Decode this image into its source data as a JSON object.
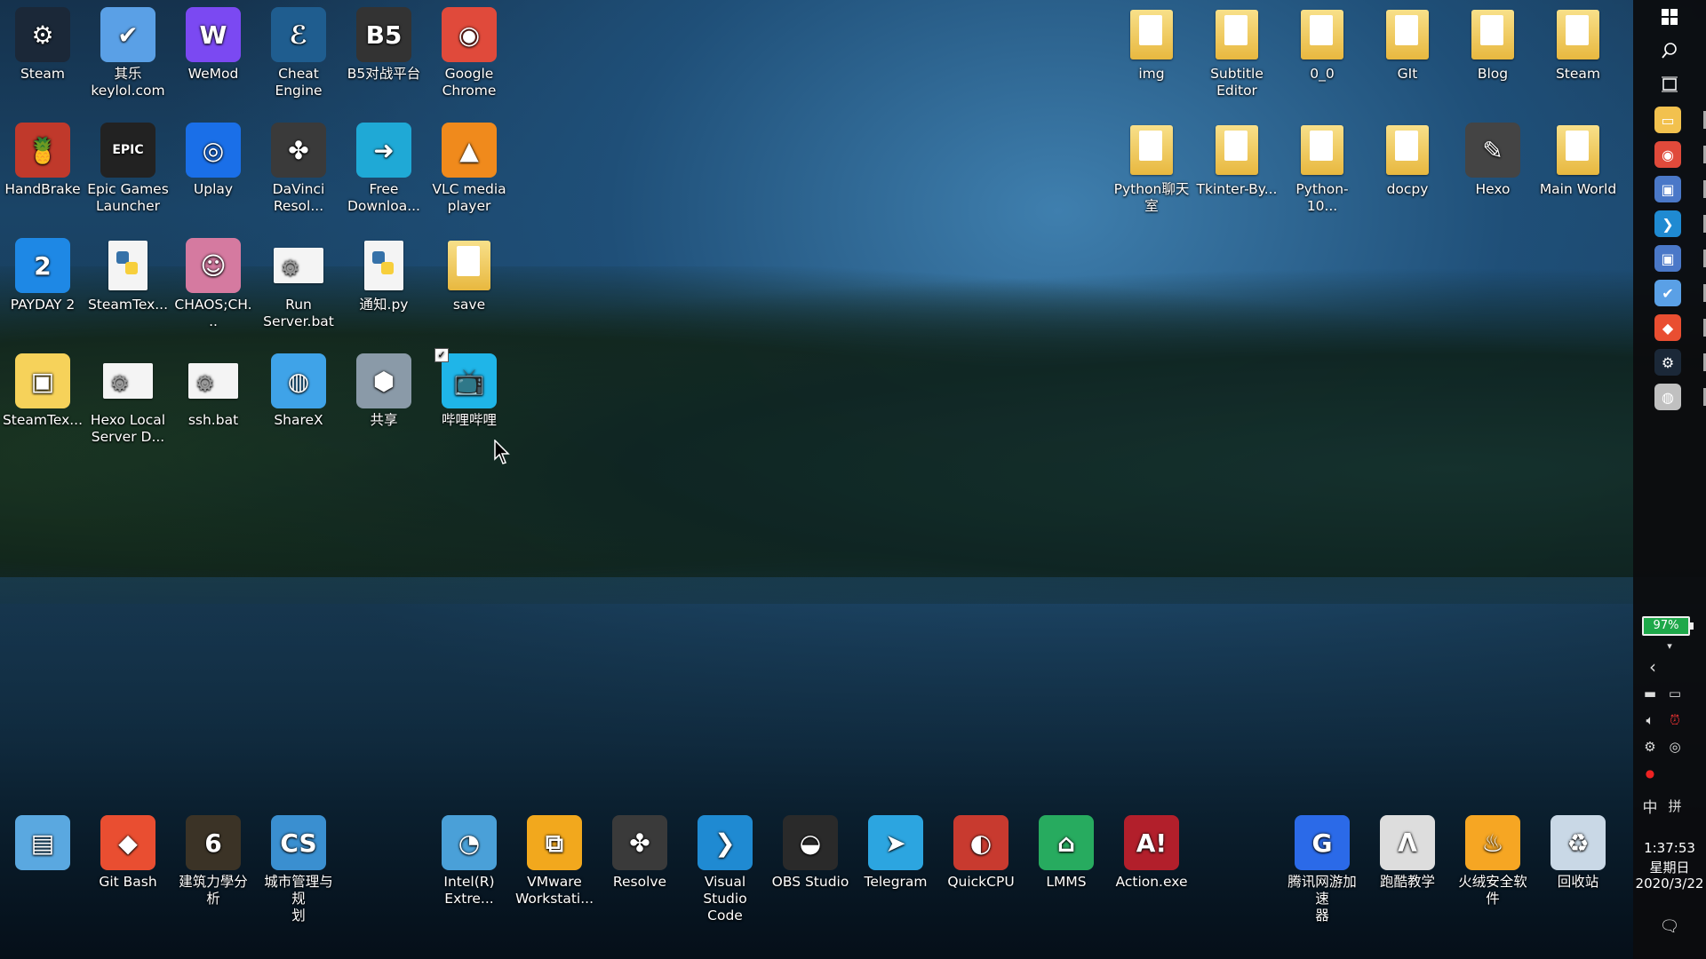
{
  "desktop": {
    "wallpaper": "misty forest lake at dusk",
    "icons": [
      {
        "label": "Steam",
        "icon": "steam-icon",
        "color": "#1b2838"
      },
      {
        "label": "其乐\nkeylol.com",
        "icon": "keylol-icon",
        "color": "#5aa0e6"
      },
      {
        "label": "WeMod",
        "icon": "wemod-icon",
        "color": "#7b49f2"
      },
      {
        "label": "Cheat\nEngine",
        "icon": "cheat-engine-icon",
        "color": "#1f5d8f"
      },
      {
        "label": "B5对战平台",
        "icon": "b5-icon",
        "color": "#333333"
      },
      {
        "label": "Google\nChrome",
        "icon": "chrome-icon",
        "color": "#e04a3b"
      },
      {
        "label": "HandBrake",
        "icon": "handbrake-icon",
        "color": "#c0392b"
      },
      {
        "label": "Epic Games\nLauncher",
        "icon": "epic-games-icon",
        "color": "#222222"
      },
      {
        "label": "Uplay",
        "icon": "uplay-icon",
        "color": "#1a6fe8"
      },
      {
        "label": "DaVinci\nResol...",
        "icon": "davinci-icon",
        "color": "#3a3a3a"
      },
      {
        "label": "Free\nDownloa...",
        "icon": "free-download-icon",
        "color": "#1fa9d6"
      },
      {
        "label": "VLC media\nplayer",
        "icon": "vlc-icon",
        "color": "#f08a1c"
      },
      {
        "label": "PAYDAY 2",
        "icon": "payday-icon",
        "color": "#1e88e5"
      },
      {
        "label": "SteamTex...",
        "icon": "python-file-icon",
        "color": "#f4f4f4"
      },
      {
        "label": "CHAOS;CH...",
        "icon": "chaos-child-icon",
        "color": "#d57aa0"
      },
      {
        "label": "Run\nServer.bat",
        "icon": "batch-file-icon",
        "color": "#f4f4f4"
      },
      {
        "label": "通知.py",
        "icon": "python-file-icon",
        "color": "#f4f4f4"
      },
      {
        "label": "save",
        "icon": "folder-icon",
        "color": "#f0c75a"
      },
      {
        "label": "SteamTex...",
        "icon": "steamtex-app-icon",
        "color": "#f6d25a"
      },
      {
        "label": "Hexo Local\nServer D...",
        "icon": "batch-file-icon",
        "color": "#f4f4f4"
      },
      {
        "label": "ssh.bat",
        "icon": "batch-file-icon",
        "color": "#f4f4f4"
      },
      {
        "label": "ShareX",
        "icon": "sharex-icon",
        "color": "#3fa3e8"
      },
      {
        "label": "共享",
        "icon": "share-box-icon",
        "color": "#8a9aa8"
      },
      {
        "label": "哔哩哔哩",
        "icon": "bilibili-icon",
        "color": "#1fb5e8"
      }
    ],
    "right_icons": [
      {
        "label": "img",
        "icon": "folder-icon"
      },
      {
        "label": "Subtitle\nEditor",
        "icon": "folder-icon"
      },
      {
        "label": "0_0",
        "icon": "folder-icon"
      },
      {
        "label": "GIt",
        "icon": "folder-icon"
      },
      {
        "label": "Blog",
        "icon": "folder-icon"
      },
      {
        "label": "Steam",
        "icon": "folder-icon"
      },
      {
        "label": "Python聊天\n室",
        "icon": "folder-icon"
      },
      {
        "label": "Tkinter-By...",
        "icon": "folder-icon"
      },
      {
        "label": "Python-10...",
        "icon": "folder-icon"
      },
      {
        "label": "docpy",
        "icon": "folder-icon"
      },
      {
        "label": "Hexo",
        "icon": "notepad-icon"
      },
      {
        "label": "Main World",
        "icon": "folder-icon"
      }
    ],
    "bottom_icons": [
      {
        "label": "",
        "icon": "control-panel-icon",
        "color": "#5aa8e0"
      },
      {
        "label": "Git Bash",
        "icon": "git-bash-icon",
        "color": "#e94e31"
      },
      {
        "label": "建筑力學分析",
        "icon": "structural-analysis-icon",
        "color": "#3b3326"
      },
      {
        "label": "城市管理与规\n划",
        "icon": "city-planning-icon",
        "color": "#3a8fd0"
      },
      {
        "label": "Intel(R)\nExtre...",
        "icon": "intel-xtu-icon",
        "color": "#4aa0d8"
      },
      {
        "label": "VMware\nWorkstati...",
        "icon": "vmware-icon",
        "color": "#f2a81d"
      },
      {
        "label": "Resolve",
        "icon": "resolve-icon",
        "color": "#3a3a3a"
      },
      {
        "label": "Visual\nStudio Code",
        "icon": "vscode-icon",
        "color": "#1f8ad2"
      },
      {
        "label": "OBS Studio",
        "icon": "obs-icon",
        "color": "#2a2a2a"
      },
      {
        "label": "Telegram",
        "icon": "telegram-icon",
        "color": "#2ca5e0"
      },
      {
        "label": "QuickCPU",
        "icon": "quickcpu-icon",
        "color": "#c83a2f"
      },
      {
        "label": "LMMS",
        "icon": "lmms-icon",
        "color": "#27ab5f"
      },
      {
        "label": "Action.exe",
        "icon": "action-icon",
        "color": "#b21f2b"
      },
      {
        "label": "腾讯网游加速\n器",
        "icon": "tencent-accel-icon",
        "color": "#2b6ae8"
      },
      {
        "label": "跑酷教学",
        "icon": "assassin-icon",
        "color": "#dddddd"
      },
      {
        "label": "火绒安全软件",
        "icon": "huorong-icon",
        "color": "#f6a623"
      },
      {
        "label": "回收站",
        "icon": "recycle-bin-icon",
        "color": "#c9d8e6"
      }
    ]
  },
  "taskbar": {
    "apps": [
      {
        "icon": "file-explorer-icon",
        "color": "#f2c14e"
      },
      {
        "icon": "chrome-icon",
        "color": "#e04a3b"
      },
      {
        "icon": "remote-desktop-icon",
        "color": "#4a78c8"
      },
      {
        "icon": "vscode-icon",
        "color": "#1f8ad2"
      },
      {
        "icon": "remote-desktop-icon",
        "color": "#4a78c8"
      },
      {
        "icon": "keylol-icon",
        "color": "#5aa0e6"
      },
      {
        "icon": "git-icon",
        "color": "#e94e31"
      },
      {
        "icon": "steam-icon",
        "color": "#1b2838"
      },
      {
        "icon": "sharex-icon",
        "color": "#c0c0c0"
      }
    ],
    "battery": "97%",
    "ime": "中",
    "ime2": "拼",
    "time": "1:37:53",
    "weekday": "星期日",
    "date": "2020/3/22"
  }
}
